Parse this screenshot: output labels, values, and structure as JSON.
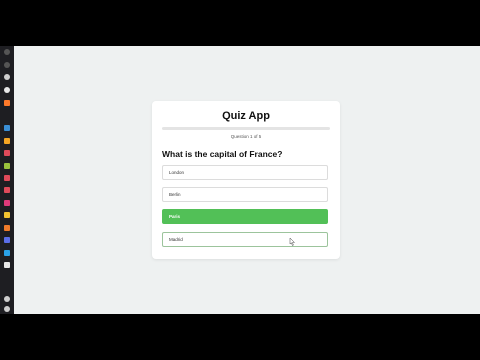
{
  "dock": {
    "icons": [
      {
        "name": "close-icon",
        "color": "#555555",
        "glyph": "×"
      },
      {
        "name": "minus-icon",
        "color": "#555555",
        "glyph": "–"
      },
      {
        "name": "settings-icon",
        "color": "#cfcfcf",
        "glyph": ""
      },
      {
        "name": "chrome-icon",
        "color": "#e8e8e8",
        "glyph": ""
      },
      {
        "name": "code-icon",
        "color": "#ff7a2a",
        "glyph": ""
      },
      {
        "name": "terminal-icon",
        "color": "#3a8fd6",
        "glyph": ""
      },
      {
        "name": "folder-icon",
        "color": "#f5a623",
        "glyph": ""
      },
      {
        "name": "app-red-icon",
        "color": "#e04a5a",
        "glyph": ""
      },
      {
        "name": "app-green-icon",
        "color": "#9bc23c",
        "glyph": ""
      },
      {
        "name": "app-red-icon-2",
        "color": "#e04a5a",
        "glyph": ""
      },
      {
        "name": "app-red-icon-3",
        "color": "#e04a5a",
        "glyph": ""
      },
      {
        "name": "app-pink-icon",
        "color": "#e03a7a",
        "glyph": ""
      },
      {
        "name": "app-yellow-icon",
        "color": "#f2c230",
        "glyph": ""
      },
      {
        "name": "app-orange-icon",
        "color": "#f07b2a",
        "glyph": ""
      },
      {
        "name": "app-blue-icon",
        "color": "#5b6ee8",
        "glyph": ""
      },
      {
        "name": "app-twitter-icon",
        "color": "#2aa2e8",
        "glyph": ""
      },
      {
        "name": "app-dark-icon",
        "color": "#e8e8e8",
        "glyph": ""
      },
      {
        "name": "app-user-icon",
        "color": "#cfcfcf",
        "glyph": ""
      },
      {
        "name": "app-settings-icon",
        "color": "#cfcfcf",
        "glyph": ""
      }
    ]
  },
  "quiz": {
    "title": "Quiz App",
    "progress_fraction": 0.0,
    "question_number": "Question 1 of 5",
    "question": "What is the capital of France?",
    "options": [
      {
        "label": "London",
        "state": "normal"
      },
      {
        "label": "Berlin",
        "state": "normal"
      },
      {
        "label": "Paris",
        "state": "correct"
      },
      {
        "label": "Madrid",
        "state": "hover"
      }
    ]
  },
  "colors": {
    "accent_correct": "#52c057",
    "background": "#eef1f1"
  }
}
